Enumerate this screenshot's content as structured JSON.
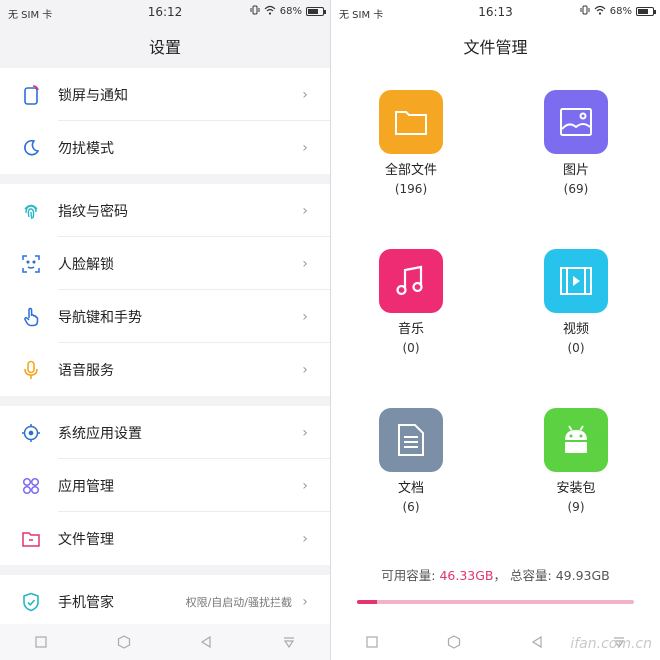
{
  "left": {
    "status": {
      "carrier": "无 SIM 卡",
      "time": "16:12",
      "battery": "68%",
      "battery_level": 0.68
    },
    "title": "设置",
    "groups": [
      [
        {
          "label": "锁屏与通知",
          "icon": "lockscreen-icon"
        },
        {
          "label": "勿扰模式",
          "icon": "moon-icon"
        }
      ],
      [
        {
          "label": "指纹与密码",
          "icon": "fingerprint-icon"
        },
        {
          "label": "人脸解锁",
          "icon": "face-unlock-icon"
        },
        {
          "label": "导航键和手势",
          "icon": "gesture-hand-icon"
        },
        {
          "label": "语音服务",
          "icon": "microphone-icon"
        }
      ],
      [
        {
          "label": "系统应用设置",
          "icon": "system-settings-icon"
        },
        {
          "label": "应用管理",
          "icon": "app-management-icon"
        },
        {
          "label": "文件管理",
          "icon": "folder-icon"
        }
      ],
      [
        {
          "label": "手机管家",
          "icon": "shield-icon",
          "sub": "权限/自启动/骚扰拦截"
        }
      ]
    ]
  },
  "right": {
    "status": {
      "carrier": "无 SIM 卡",
      "time": "16:13",
      "battery": "68%",
      "battery_level": 0.68
    },
    "title": "文件管理",
    "tiles": [
      {
        "name": "全部文件",
        "count": "(196)",
        "icon": "folder-icon",
        "color": "#f5a623"
      },
      {
        "name": "图片",
        "count": "(69)",
        "icon": "image-icon",
        "color": "#7b6cf0"
      },
      {
        "name": "音乐",
        "count": "(0)",
        "icon": "music-note-icon",
        "color": "#ee2c74"
      },
      {
        "name": "视频",
        "count": "(0)",
        "icon": "video-icon",
        "color": "#27c3ec"
      },
      {
        "name": "文档",
        "count": "(6)",
        "icon": "document-icon",
        "color": "#7b8fa6"
      },
      {
        "name": "安装包",
        "count": "(9)",
        "icon": "android-icon",
        "color": "#5cd141"
      }
    ],
    "storage": {
      "available_label": "可用容量:",
      "available": "46.33GB",
      "separator": "，",
      "total_label": "总容量:",
      "total": "49.93GB",
      "used_fraction": 0.072
    },
    "watermark": "ifan.com.cn"
  },
  "chevron": "›",
  "colors": {
    "accent_blue": "#2a6fd6",
    "accent_pink": "#e2346f"
  }
}
